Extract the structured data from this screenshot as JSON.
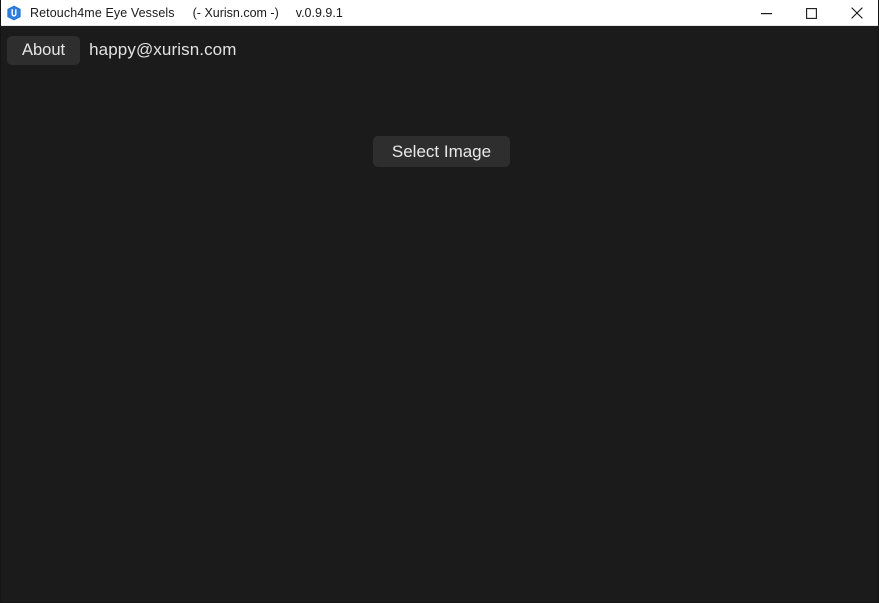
{
  "window": {
    "title_main": "Retouch4me Eye Vessels",
    "title_site": "(- Xurisn.com -)",
    "title_version": "v.0.9.9.1",
    "icon_name": "app-logo-icon",
    "titlebar_bg": "#ffffff",
    "body_bg": "#1b1b1b",
    "controls": {
      "minimize_label": "Minimize",
      "maximize_label": "Maximize",
      "close_label": "Close"
    }
  },
  "menu": {
    "about_label": "About",
    "email": "happy@xurisn.com",
    "button_bg": "#2e2e2e",
    "text_color": "#e6e6e6"
  },
  "main": {
    "select_image_label": "Select Image",
    "button_bg": "#2e2e2e",
    "background": "#1b1b1b"
  }
}
